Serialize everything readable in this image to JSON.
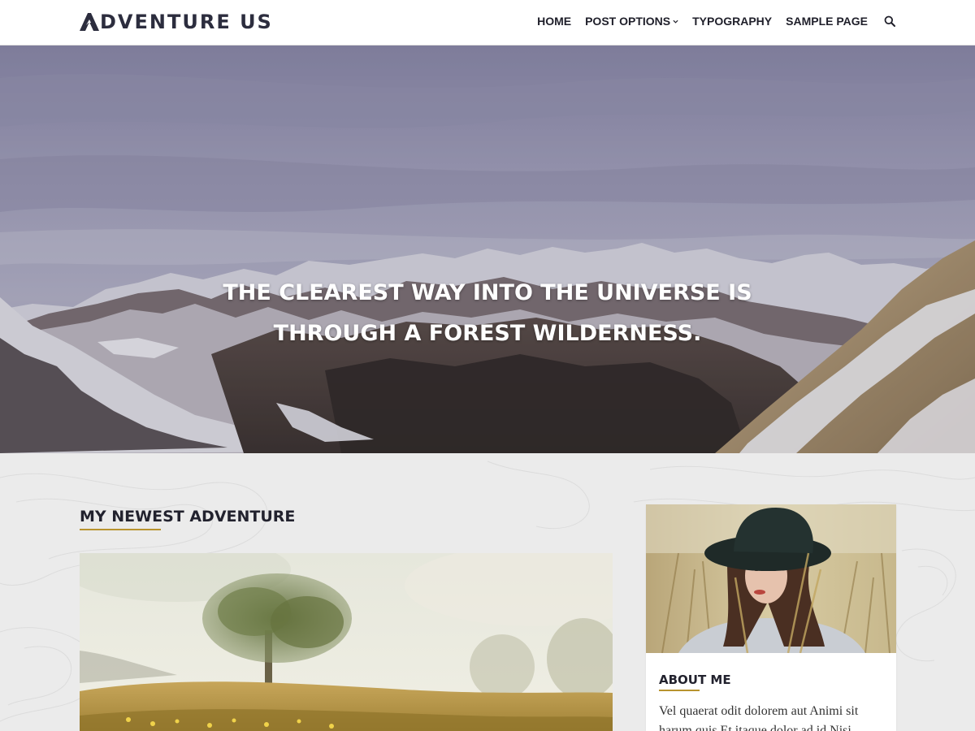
{
  "site": {
    "logo_text": "DVENTURE US"
  },
  "nav": {
    "items": [
      "HOME",
      "POST OPTIONS",
      "TYPOGRAPHY",
      "SAMPLE PAGE"
    ],
    "search_icon": "search-icon",
    "dropdown_icon": "chevron-down-icon"
  },
  "hero": {
    "quote_line1": "THE CLEAREST WAY INTO THE UNIVERSE IS",
    "quote_line2": "THROUGH A FOREST WILDERNESS."
  },
  "main": {
    "section_title": "MY NEWEST ADVENTURE"
  },
  "sidebar": {
    "widget_title": "ABOUT ME",
    "widget_text": "Vel quaerat odit dolorem aut Animi sit harum quis Et itaque dolor ad id Nisi"
  },
  "colors": {
    "accent": "#b8932e",
    "header_bg": "#ffffff",
    "page_bg": "#ebebeb",
    "text_dark": "#22222e"
  }
}
